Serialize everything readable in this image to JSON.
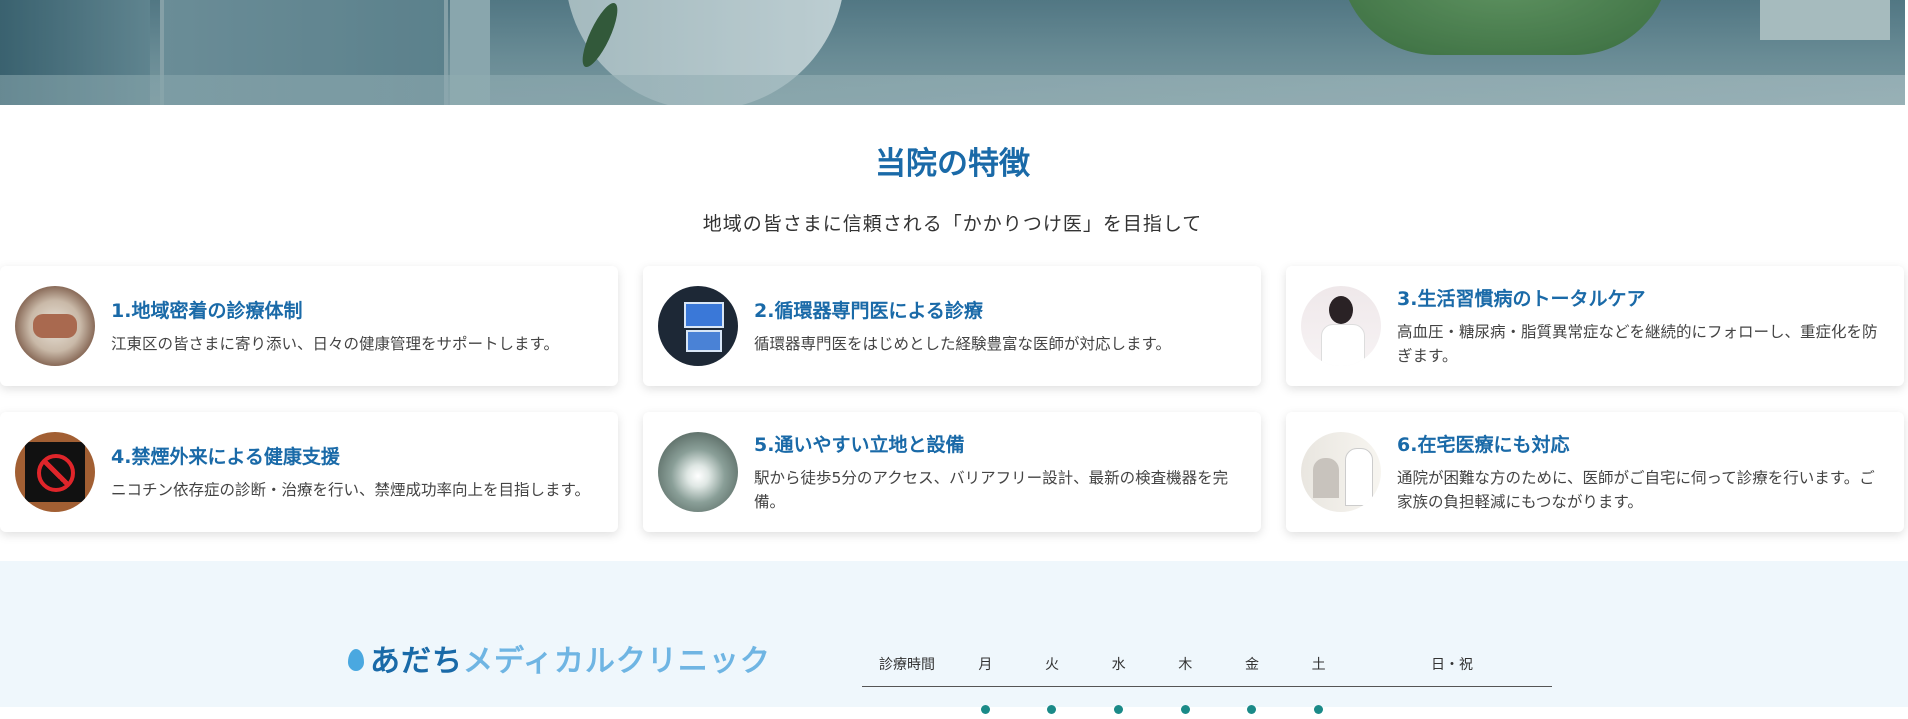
{
  "section": {
    "title": "当院の特徴",
    "subtitle": "地域の皆さまに信頼される「かかりつけ医」を目指して"
  },
  "features": [
    {
      "title": "1.地域密着の診療体制",
      "text": "江東区の皆さまに寄り添い、日々の健康管理をサポートします。",
      "image": "team-hands-photo"
    },
    {
      "title": "2.循環器専門医による診療",
      "text": "循環器専門医をはじめとした経験豊富な医師が対応します。",
      "image": "medical-monitor-photo"
    },
    {
      "title": "3.生活習慣病のトータルケア",
      "text": "高血圧・糖尿病・脂質異常症などを継続的にフォローし、重症化を防ぎます。",
      "image": "doctor-photo"
    },
    {
      "title": "4.禁煙外来による健康支援",
      "text": "ニコチン依存症の診断・治療を行い、禁煙成功率向上を目指します。",
      "image": "no-smoking-sign-photo"
    },
    {
      "title": "5.通いやすい立地と設備",
      "text": "駅から徒歩5分のアクセス、バリアフリー設計、最新の検査機器を完備。",
      "image": "corridor-photo"
    },
    {
      "title": "6.在宅医療にも対応",
      "text": "通院が困難な方のために、医師がご自宅に伺って診療を行います。ご家族の負担軽減にもつながります。",
      "image": "home-visit-photo"
    }
  ],
  "footer": {
    "logo_main": "あだち",
    "logo_sub": "メディカルクリニック",
    "hours_header": [
      "診療時間",
      "月",
      "火",
      "水",
      "木",
      "金",
      "土",
      "日・祝"
    ]
  },
  "colors": {
    "accent": "#1a6aa8",
    "footer_bg": "#eff7fc",
    "logo_light": "#6fb5e3"
  }
}
